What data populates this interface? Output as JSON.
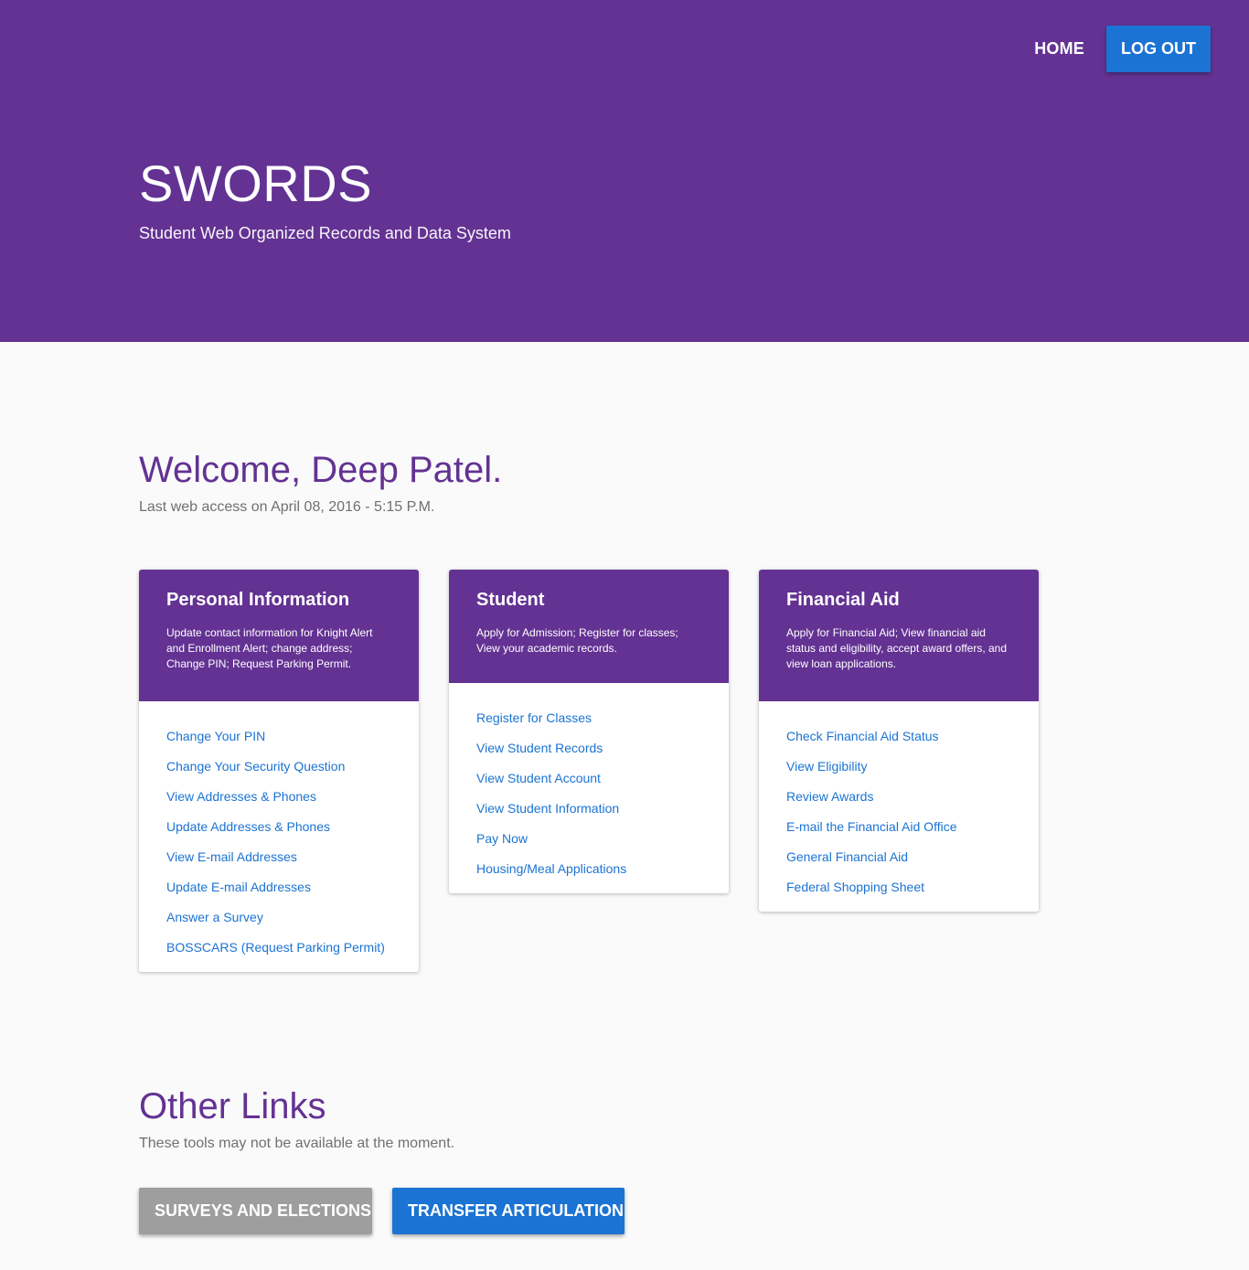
{
  "header": {
    "nav": {
      "home": "HOME",
      "logout": "LOG OUT"
    },
    "title": "SWORDS",
    "subtitle": "Student Web Organized Records and Data System"
  },
  "welcome": {
    "heading": "Welcome, Deep Patel.",
    "last_access": "Last web access on April 08, 2016 - 5:15 P.M."
  },
  "cards": [
    {
      "title": "Personal Information",
      "description": "Update contact information for Knight Alert and Enrollment Alert; change address; Change PIN; Request Parking Permit.",
      "links": [
        "Change Your PIN",
        "Change Your Security Question",
        "View Addresses & Phones",
        "Update Addresses & Phones",
        "View E-mail Addresses",
        "Update E-mail Addresses",
        "Answer a Survey",
        "BOSSCARS (Request Parking Permit)"
      ]
    },
    {
      "title": "Student",
      "description": "Apply for Admission; Register for classes; View your academic records.",
      "links": [
        "Register for Classes",
        "View Student Records",
        "View Student Account",
        "View Student Information",
        "Pay Now",
        "Housing/Meal Applications"
      ]
    },
    {
      "title": "Financial Aid",
      "description": "Apply for Financial Aid; View financial aid status and eligibility, accept award offers, and view loan applications.",
      "links": [
        "Check Financial Aid Status",
        "View Eligibility",
        "Review Awards",
        "E-mail the Financial Aid Office",
        "General Financial Aid",
        "Federal Shopping Sheet"
      ]
    }
  ],
  "other_links": {
    "heading": "Other Links",
    "subtitle": "These tools may not be available at the moment.",
    "buttons": {
      "surveys": "SURVEYS AND ELECTIONS",
      "transfer": "TRANSFER ARTICULATION"
    }
  },
  "colors": {
    "brand": "#633293",
    "accent": "#1b73d3",
    "disabled": "#9e9e9e"
  }
}
